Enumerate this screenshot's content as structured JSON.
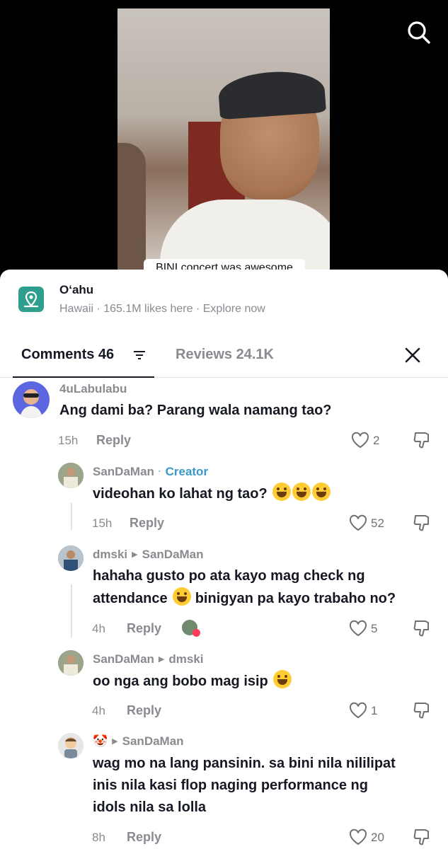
{
  "video": {
    "caption": "BINI concert was awesome"
  },
  "location": {
    "title": "O‘ahu",
    "subtitle": "Hawaii · 165.1M likes here · Explore now",
    "icon": "map-pin-icon"
  },
  "tabs": {
    "comments_label": "Comments 46",
    "reviews_label": "Reviews 24.1K"
  },
  "comments": [
    {
      "user": "4uLabulabu",
      "text": "Ang dami ba? Parang wala namang tao?",
      "time": "15h",
      "reply": "Reply",
      "likes": "2"
    },
    {
      "user": "SanDaMan",
      "badge": "Creator",
      "text": "videohan ko lahat ng tao?",
      "time": "15h",
      "reply": "Reply",
      "likes": "52"
    },
    {
      "user": "dmski",
      "reply_to": "SanDaMan",
      "text_a": "hahaha gusto po ata kayo mag check ng",
      "text_b": "attendance",
      "text_c": "binigyan pa kayo trabaho no?",
      "time": "4h",
      "reply": "Reply",
      "likes": "5"
    },
    {
      "user": "SanDaMan",
      "reply_to": "dmski",
      "text": "oo nga ang bobo mag isip",
      "time": "4h",
      "reply": "Reply",
      "likes": "1"
    },
    {
      "user": "🤡",
      "reply_to": "SanDaMan",
      "text_1": "wag mo na lang pansinin. sa bini nila nililipat",
      "text_2": "inis nila kasi flop naging performance ng",
      "text_3": "idols nila sa lolla",
      "time": "8h",
      "reply": "Reply",
      "likes": "20"
    }
  ]
}
